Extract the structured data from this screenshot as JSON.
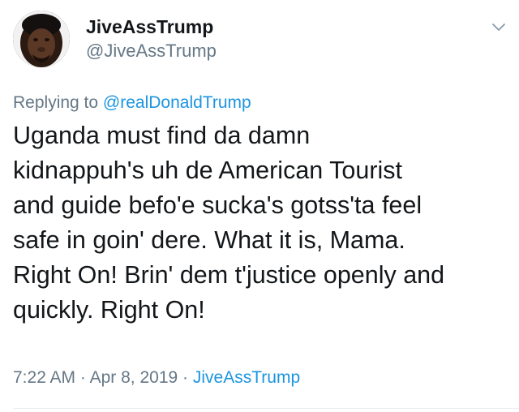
{
  "author": {
    "display_name": "JiveAssTrump",
    "handle": "@JiveAssTrump",
    "avatar_icon": "avatar-photo"
  },
  "menu_icon": "chevron-down-icon",
  "reply": {
    "prefix": "Replying to",
    "mention": "@realDonaldTrump"
  },
  "tweet": {
    "lines": [
      "Uganda must find da damn",
      "kidnappuh's uh de American Tourist",
      "and guide befo'e sucka's gotss'ta feel",
      "safe in goin' dere. What it is, Mama.",
      "Right On! Brin' dem t'justice openly and",
      "quickly. Right On!"
    ]
  },
  "meta": {
    "time": "7:22 AM",
    "separator": "·",
    "date": "Apr 8, 2019",
    "source": "JiveAssTrump"
  },
  "colors": {
    "text": "#14171a",
    "secondary": "#657786",
    "link": "#1b95e0",
    "divider": "#e6ecf0"
  }
}
